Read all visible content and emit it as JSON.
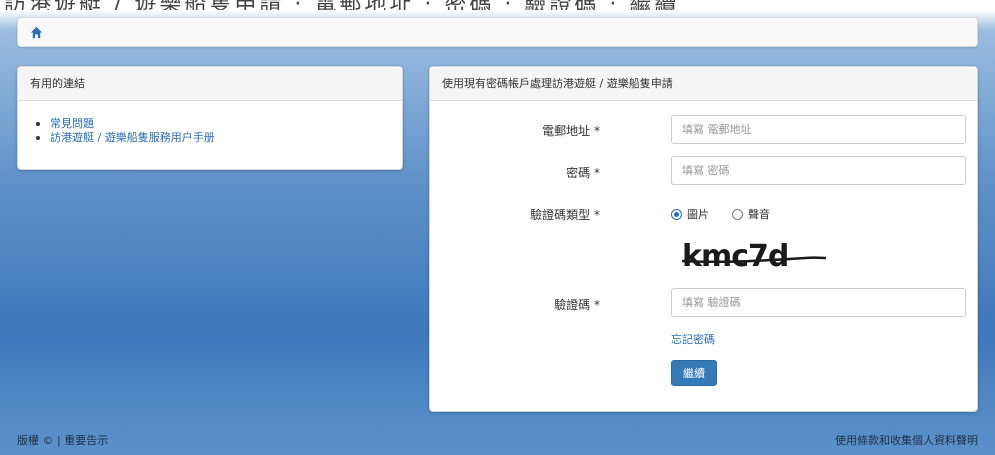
{
  "top_strip": {
    "text": "訪港遊艇 / 遊樂船隻申請 · 電郵地址 · 密碼 · 驗證碼 · 繼續"
  },
  "nav": {
    "home_icon": "home-icon"
  },
  "links_panel": {
    "title": "有用的連結",
    "items": [
      {
        "label": "常見問題"
      },
      {
        "label": "訪港遊艇 / 遊樂船隻服務用户手册"
      }
    ]
  },
  "form_panel": {
    "title": "使用現有密碼帳戶處理訪港遊艇 / 遊樂船隻申請",
    "email": {
      "label": "電郵地址 *",
      "placeholder": "填寫 電郵地址"
    },
    "password": {
      "label": "密碼 *",
      "placeholder": "填寫 密碼"
    },
    "captcha_type": {
      "label": "驗證碼類型 *",
      "options": [
        {
          "label": "圖片",
          "checked": true
        },
        {
          "label": "聲音",
          "checked": false
        }
      ]
    },
    "captcha_image_text": "kmc7d",
    "captcha": {
      "label": "驗證碼 *",
      "placeholder": "填寫 驗證碼"
    },
    "forgot_password": "忘記密碼",
    "continue_button": "繼續"
  },
  "footer": {
    "left": "版權 © | 重要告示",
    "right": "使用條款和收集個人資料聲明"
  },
  "colors": {
    "accent": "#337ab7",
    "link": "#2a6db5",
    "background_top": "#9bbde0",
    "background_mid": "#3f78bd"
  }
}
